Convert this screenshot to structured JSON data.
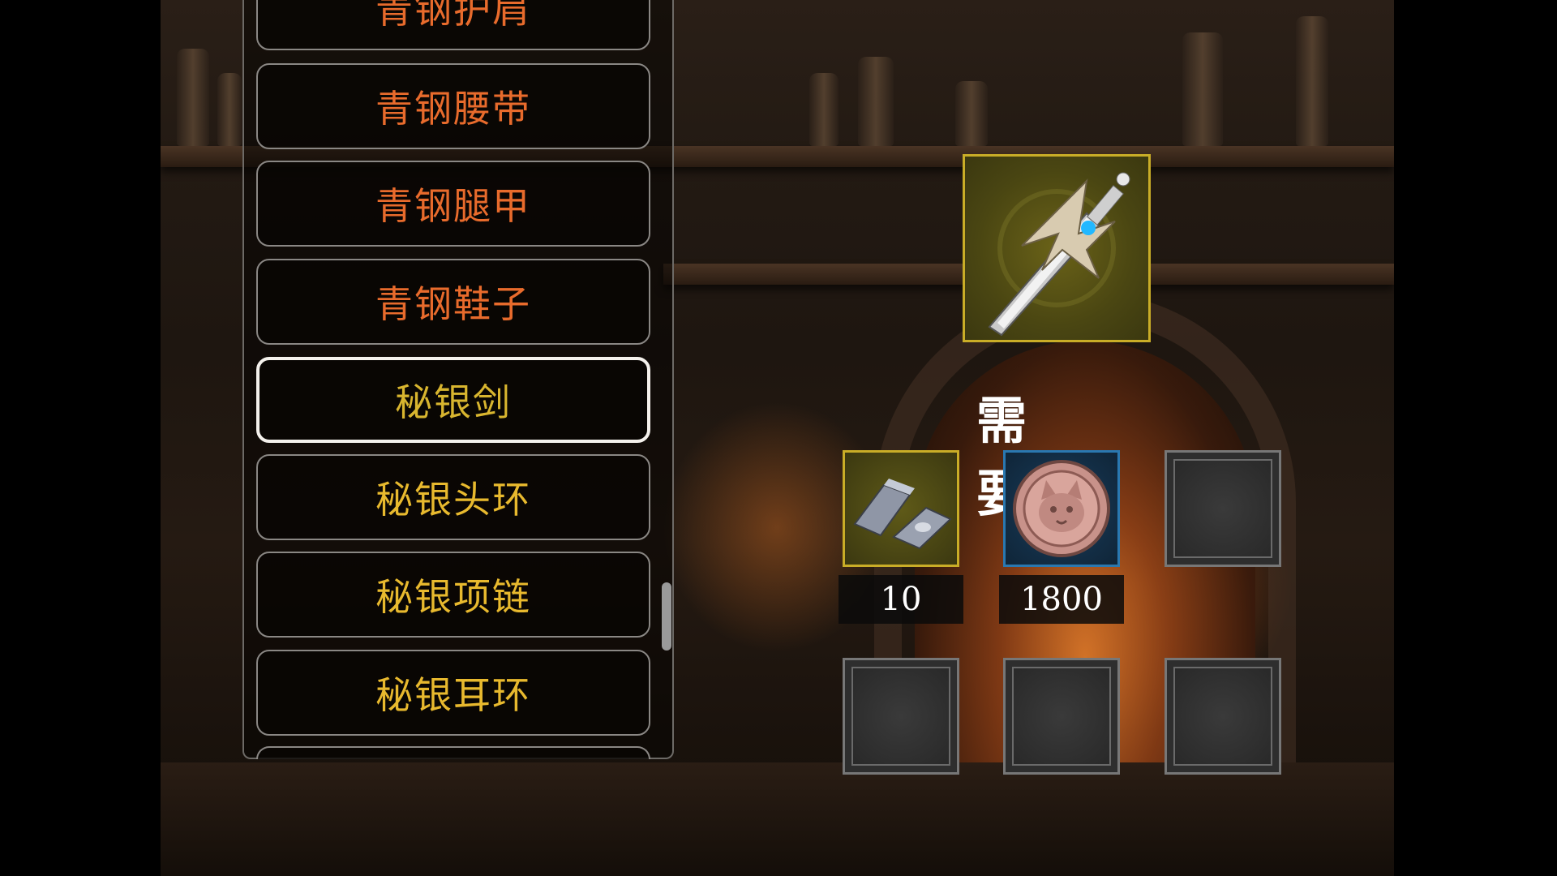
{
  "recipe_list": {
    "items": [
      {
        "label": "青钢护肩"
      },
      {
        "label": "青钢腰带"
      },
      {
        "label": "青钢腿甲"
      },
      {
        "label": "青钢鞋子"
      },
      {
        "label": "秘银剑"
      },
      {
        "label": "秘银头环"
      },
      {
        "label": "秘银项链"
      },
      {
        "label": "秘银耳环"
      }
    ],
    "selected_label": "秘银剑"
  },
  "crafting": {
    "result_icon": "mithril-sword-icon",
    "requirements_label": "需　要：",
    "materials": [
      {
        "icon": "silver-ingot-icon",
        "count": "10"
      },
      {
        "icon": "cat-coin-icon",
        "count": "1800"
      }
    ]
  },
  "colors": {
    "bronze_text": "#e86b2c",
    "mithril_text": "#e8b92e",
    "gold_frame": "#c9ad27",
    "blue_frame": "#2a78b0"
  }
}
